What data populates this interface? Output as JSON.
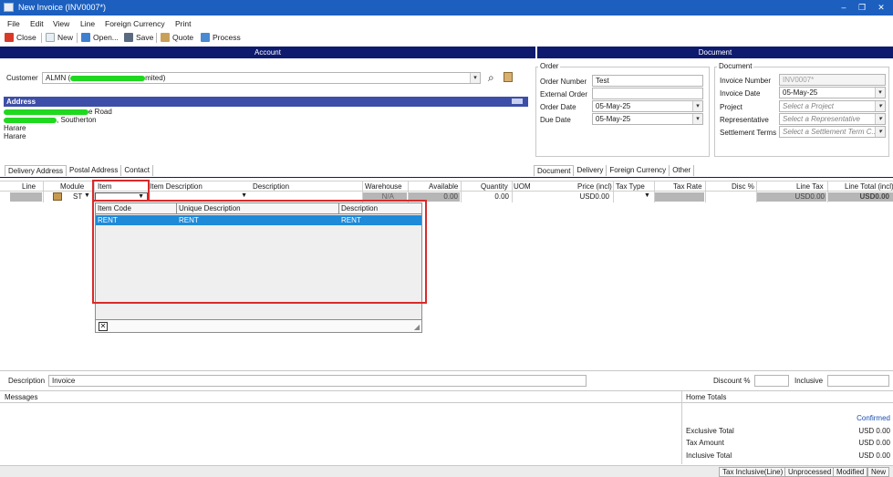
{
  "window": {
    "title": "New Invoice (INV0007*)",
    "controls": [
      "–",
      "❐",
      "✕"
    ]
  },
  "menu": [
    "File",
    "Edit",
    "View",
    "Line",
    "Foreign Currency",
    "Print"
  ],
  "toolbar": {
    "close": "Close",
    "new": "New",
    "open": "Open...",
    "save": "Save",
    "quote": "Quote",
    "process": "Process"
  },
  "sections": {
    "account": "Account",
    "document": "Document"
  },
  "customer": {
    "label": "Customer",
    "value_prefix": "ALMN (",
    "value_suffix": "mited)"
  },
  "address": {
    "header": "Address",
    "line1_suffix": "e Road",
    "line2_suffix": ", Southerton",
    "line3": "Harare",
    "line4": "Harare"
  },
  "order": {
    "group": "Order",
    "order_number_label": "Order Number",
    "order_number": "Test",
    "external_order_label": "External Order",
    "external_order": "",
    "order_date_label": "Order Date",
    "order_date": "05-May-25",
    "due_date_label": "Due Date",
    "due_date": "05-May-25"
  },
  "document": {
    "group": "Document",
    "invoice_number_label": "Invoice Number",
    "invoice_number": "INV0007*",
    "invoice_date_label": "Invoice Date",
    "invoice_date": "05-May-25",
    "project_label": "Project",
    "project_placeholder": "Select a Project",
    "rep_label": "Representative",
    "rep_placeholder": "Select a Representative",
    "terms_label": "Settlement Terms",
    "terms_placeholder": "Select a Settlement Term C..."
  },
  "left_tabs": [
    "Delivery Address",
    "Postal Address",
    "Contact"
  ],
  "right_tabs": [
    "Document",
    "Delivery",
    "Foreign Currency",
    "Other"
  ],
  "grid": {
    "columns": [
      "Line",
      "Module",
      "Item",
      "Item Description",
      "Description",
      "Warehouse",
      "Available",
      "Quantity",
      "UOM",
      "Price (incl)",
      "Tax Type",
      "Tax Rate",
      "Disc %",
      "Line Tax",
      "Line Total (incl)"
    ],
    "row": {
      "module": "ST",
      "warehouse": "N/A",
      "available": "0.00",
      "quantity": "0.00",
      "price": "USD0.00",
      "line_tax": "USD0.00",
      "line_total": "USD0.00"
    }
  },
  "item_popup": {
    "columns": [
      "Item Code",
      "Unique Description",
      "Description"
    ],
    "rows": [
      {
        "code": "RENT",
        "unique": "RENT",
        "desc": "RENT"
      }
    ],
    "close": "✕"
  },
  "bottom": {
    "description_label": "Description",
    "description": "Invoice",
    "discount_label": "Discount %",
    "inclusive_label": "Inclusive",
    "messages_label": "Messages",
    "home_totals_label": "Home Totals",
    "status": "Confirmed",
    "exclusive_label": "Exclusive Total",
    "exclusive": "USD 0.00",
    "tax_label": "Tax Amount",
    "tax": "USD 0.00",
    "inclusive_total_label": "Inclusive Total",
    "inclusive_total": "USD 0.00"
  },
  "statusbar": [
    "Tax Inclusive(Line)",
    "Unprocessed",
    "Modified",
    "New"
  ],
  "colors": {
    "title": "#1c5fbf",
    "navy": "#0e1a6e",
    "selection": "#1e8ad8",
    "highlight": "#d92a2a",
    "redaction": "#1fd81f"
  }
}
